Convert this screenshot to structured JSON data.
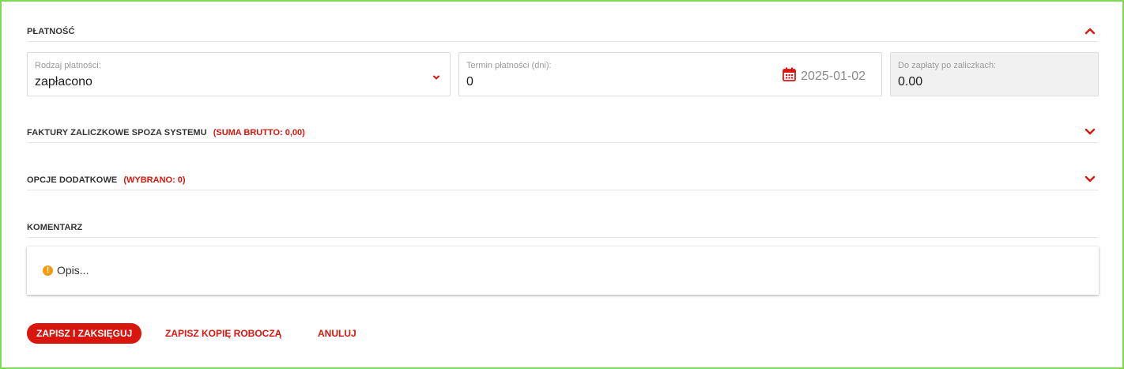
{
  "payment": {
    "title": "PŁATNOŚĆ",
    "payment_type_label": "Rodzaj płatności:",
    "payment_type_value": "zapłacono",
    "term_label": "Termin płatności (dni):",
    "term_value": "0",
    "due_date": "2025-01-02",
    "to_pay_label": "Do zapłaty po zaliczkach:",
    "to_pay_value": "0.00"
  },
  "advance_invoices": {
    "title": "FAKTURY ZALICZKOWE SPOZA SYSTEMU",
    "extra": "(SUMA BRUTTO: 0,00)"
  },
  "additional_options": {
    "title": "OPCJE DODATKOWE",
    "extra": "(WYBRANO: 0)"
  },
  "comment": {
    "title": "KOMENTARZ",
    "placeholder": "Opis..."
  },
  "actions": {
    "save_and_post": "ZAPISZ I ZAKSIĘGUJ",
    "save_draft": "ZAPISZ KOPIĘ ROBOCZĄ",
    "cancel": "ANULUJ"
  },
  "colors": {
    "accent": "#d9160e",
    "frame": "#7ed957",
    "warning": "#f39c12"
  },
  "icons": {
    "collapse": "chevron-up-icon",
    "expand": "chevron-down-icon",
    "calendar": "calendar-icon",
    "warning": "warning-icon"
  }
}
